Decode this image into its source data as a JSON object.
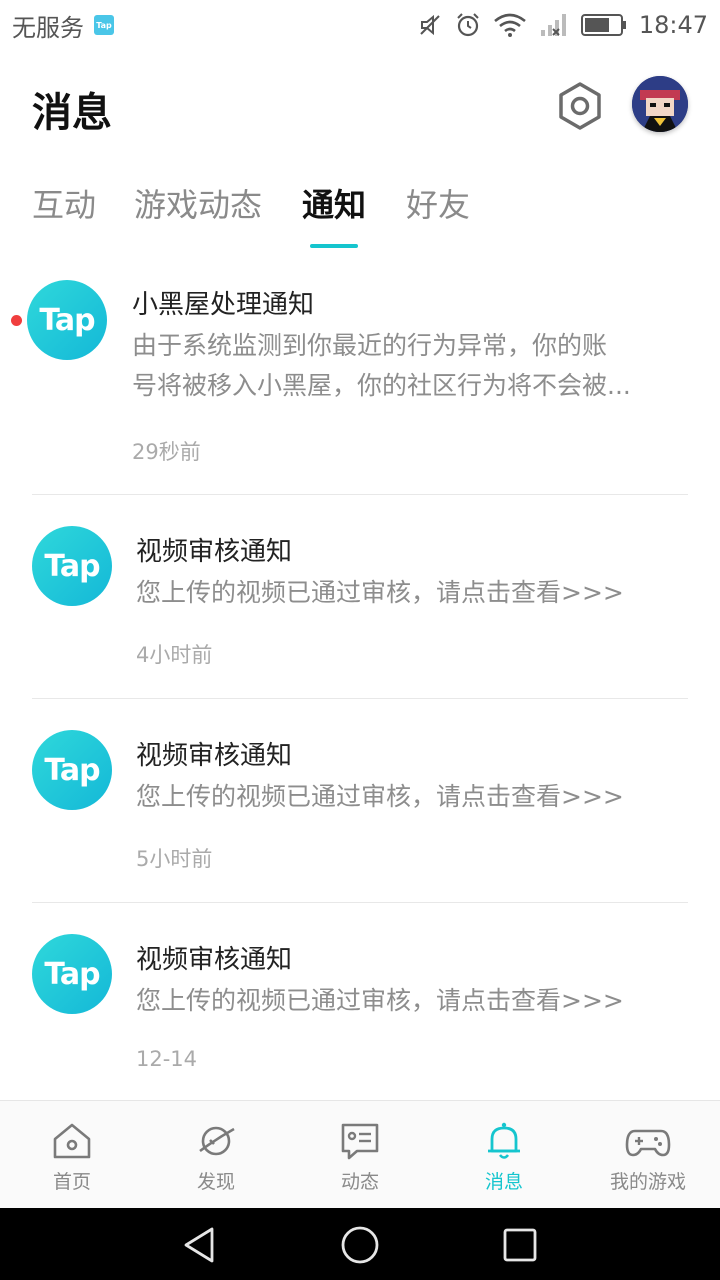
{
  "status_bar": {
    "carrier": "无服务",
    "app_badge": "Tap",
    "time": "18:47",
    "icons": [
      "mute-icon",
      "alarm-icon",
      "wifi-icon",
      "signal-icon",
      "battery-icon"
    ]
  },
  "header": {
    "title": "消息",
    "settings_icon": "settings-hexagon-icon",
    "avatar": "user-avatar"
  },
  "tabs": [
    {
      "label": "互动",
      "active": false
    },
    {
      "label": "游戏动态",
      "active": false
    },
    {
      "label": "通知",
      "active": true
    },
    {
      "label": "好友",
      "active": false
    }
  ],
  "notifications": [
    {
      "logo_text": "Tap",
      "unread": true,
      "title": "小黑屋处理通知",
      "body_line1": "由于系统监测到你最近的行为异常，你的账",
      "body_line2": "号将被移入小黑屋，你的社区行为将不会被...",
      "time": "29秒前"
    },
    {
      "logo_text": "Tap",
      "unread": false,
      "title": "视频审核通知",
      "body_line1": "您上传的视频已通过审核，请点击查看>>>",
      "time": "4小时前"
    },
    {
      "logo_text": "Tap",
      "unread": false,
      "title": "视频审核通知",
      "body_line1": "您上传的视频已通过审核，请点击查看>>>",
      "time": "5小时前"
    },
    {
      "logo_text": "Tap",
      "unread": false,
      "title": "视频审核通知",
      "body_line1": "您上传的视频已通过审核，请点击查看>>>",
      "time": "12-14"
    }
  ],
  "bottom_nav": [
    {
      "label": "首页",
      "icon": "home-icon",
      "active": false
    },
    {
      "label": "发现",
      "icon": "planet-icon",
      "active": false
    },
    {
      "label": "动态",
      "icon": "feed-chat-icon",
      "active": false
    },
    {
      "label": "消息",
      "icon": "bell-icon",
      "active": true
    },
    {
      "label": "我的游戏",
      "icon": "gamepad-icon",
      "active": false
    }
  ],
  "colors": {
    "accent": "#15c5ce",
    "unread_dot": "#f03e3e",
    "secondary_text": "#8d8d8d"
  }
}
